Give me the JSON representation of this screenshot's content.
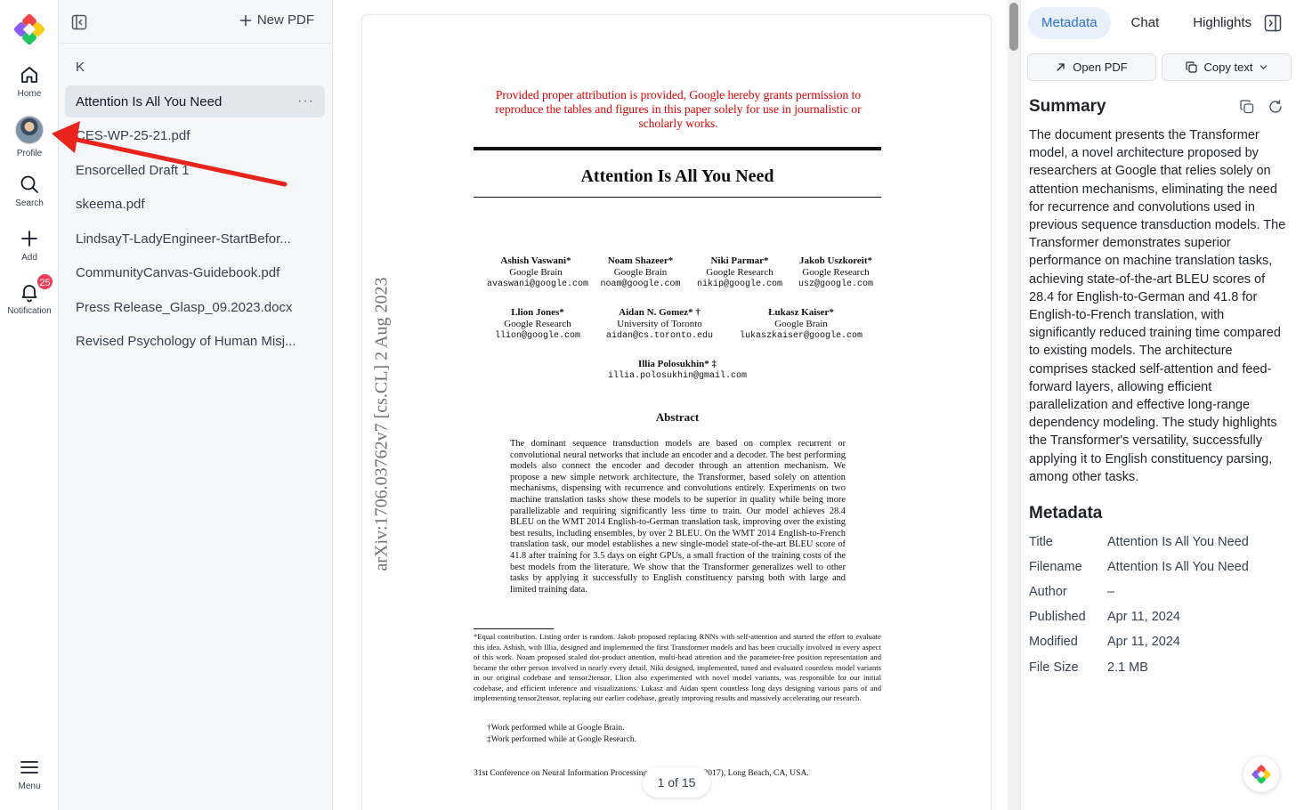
{
  "nav": {
    "home": "Home",
    "profile": "Profile",
    "search": "Search",
    "add": "Add",
    "notification": "Notification",
    "notification_count": "25",
    "menu": "Menu"
  },
  "files": {
    "new_pdf": "New PDF",
    "folder": "K",
    "items": [
      {
        "label": "Attention Is All You Need",
        "active": true
      },
      {
        "label": "CES-WP-25-21.pdf"
      },
      {
        "label": "Ensorcelled Draft 1"
      },
      {
        "label": "skeema.pdf"
      },
      {
        "label": "LindsayT-LadyEngineer-StartBefor..."
      },
      {
        "label": "CommunityCanvas-Guidebook.pdf"
      },
      {
        "label": "Press Release_Glasp_09.2023.docx"
      },
      {
        "label": "Revised Psychology of Human Misj..."
      }
    ]
  },
  "pdf": {
    "notice": "Provided proper attribution is provided, Google hereby grants permission to reproduce the tables and figures in this paper solely for use in journalistic or scholarly works.",
    "title": "Attention Is All You Need",
    "authors": [
      {
        "name": "Ashish Vaswani*",
        "org": "Google Brain",
        "email": "avaswani@google.com"
      },
      {
        "name": "Noam Shazeer*",
        "org": "Google Brain",
        "email": "noam@google.com"
      },
      {
        "name": "Niki Parmar*",
        "org": "Google Research",
        "email": "nikip@google.com"
      },
      {
        "name": "Jakob Uszkoreit*",
        "org": "Google Research",
        "email": "usz@google.com"
      },
      {
        "name": "Llion Jones*",
        "org": "Google Research",
        "email": "llion@google.com"
      },
      {
        "name": "Aidan N. Gomez* †",
        "org": "University of Toronto",
        "email": "aidan@cs.toronto.edu"
      },
      {
        "name": "Łukasz Kaiser*",
        "org": "Google Brain",
        "email": "lukaszkaiser@google.com"
      },
      {
        "name": "Illia Polosukhin* ‡",
        "org": "",
        "email": "illia.polosukhin@gmail.com"
      }
    ],
    "abstract_heading": "Abstract",
    "abstract": "The dominant sequence transduction models are based on complex recurrent or convolutional neural networks that include an encoder and a decoder. The best performing models also connect the encoder and decoder through an attention mechanism. We propose a new simple network architecture, the Transformer, based solely on attention mechanisms, dispensing with recurrence and convolutions entirely. Experiments on two machine translation tasks show these models to be superior in quality while being more parallelizable and requiring significantly less time to train. Our model achieves 28.4 BLEU on the WMT 2014 English-to-German translation task, improving over the existing best results, including ensembles, by over 2 BLEU. On the WMT 2014 English-to-French translation task, our model establishes a new single-model state-of-the-art BLEU score of 41.8 after training for 3.5 days on eight GPUs, a small fraction of the training costs of the best models from the literature. We show that the Transformer generalizes well to other tasks by applying it successfully to English constituency parsing both with large and limited training data.",
    "footnote": "*Equal contribution. Listing order is random. Jakob proposed replacing RNNs with self-attention and started the effort to evaluate this idea. Ashish, with Illia, designed and implemented the first Transformer models and has been crucially involved in every aspect of this work. Noam proposed scaled dot-product attention, multi-head attention and the parameter-free position representation and became the other person involved in nearly every detail. Niki designed, implemented, tuned and evaluated countless model variants in our original codebase and tensor2tensor. Llion also experimented with novel model variants, was responsible for our initial codebase, and efficient inference and visualizations. Lukasz and Aidan spent countless long days designing various parts of and implementing tensor2tensor, replacing our earlier codebase, greatly improving results and massively accelerating our research.",
    "footnote_dagger": "†Work performed while at Google Brain.",
    "footnote_ddagger": "‡Work performed while at Google Research.",
    "conference": "31st Conference on Neural Information Processing Systems (NIPS 2017), Long Beach, CA, USA.",
    "arxiv_stamp": "arXiv:1706.03762v7  [cs.CL]  2 Aug 2023",
    "page_indicator": "1 of 15"
  },
  "side": {
    "tabs": [
      "Metadata",
      "Chat",
      "Highlights"
    ],
    "open_pdf": "Open PDF",
    "copy_text": "Copy text",
    "summary_heading": "Summary",
    "summary": "The document presents the Transformer model, a novel architecture proposed by researchers at Google that relies solely on attention mechanisms, eliminating the need for recurrence and convolutions used in previous sequence transduction models. The Transformer demonstrates superior performance on machine translation tasks, achieving state-of-the-art BLEU scores of 28.4 for English-to-German and 41.8 for English-to-French translation, with significantly reduced training time compared to existing models. The architecture comprises stacked self-attention and feed-forward layers, allowing efficient parallelization and effective long-range dependency modeling. The study highlights the Transformer's versatility, successfully applying it to English constituency parsing, among other tasks.",
    "metadata_heading": "Metadata",
    "metadata": [
      {
        "k": "Title",
        "v": "Attention Is All You Need"
      },
      {
        "k": "Filename",
        "v": "Attention Is All You Need"
      },
      {
        "k": "Author",
        "v": "–"
      },
      {
        "k": "Published",
        "v": "Apr 11, 2024"
      },
      {
        "k": "Modified",
        "v": "Apr 11, 2024"
      },
      {
        "k": "File Size",
        "v": "2.1 MB"
      }
    ]
  },
  "colors": {
    "accent": "#2b6fd6",
    "badge": "#ef3b56",
    "arrow": "#e8251c",
    "notice": "#e10000"
  }
}
